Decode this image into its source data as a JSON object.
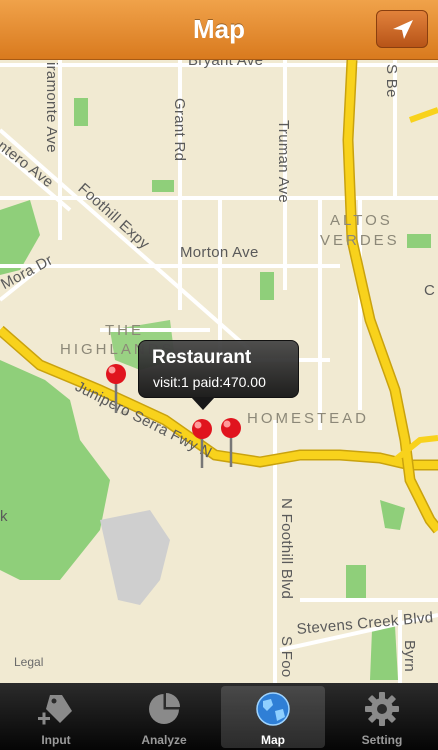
{
  "navbar": {
    "title": "Map",
    "locate_icon": "location-arrow-icon"
  },
  "map": {
    "streets": {
      "bryant": "Bryant Ave",
      "miramonte": "iramonte Ave",
      "grant": "Grant Rd",
      "truman": "Truman Ave",
      "sbe": "S Be",
      "montero": "ontero Ave",
      "foothill_expy": "Foothill Expy",
      "morton": "Morton Ave",
      "mora": "Mora Dr",
      "junipero": "Junipero Serra Fwy N",
      "n_foothill": "N Foothill Blvd",
      "s_foo": "S Foo",
      "stevens": "Stevens Creek Blvd",
      "byrn": "Byrn",
      "k": "k",
      "c": "C"
    },
    "areas": {
      "altos": "ALTOS",
      "verdes": "VERDES",
      "the": "THE",
      "highlands": "HIGHLANDS",
      "homestead": "HOMESTEAD"
    },
    "legal": "Legal"
  },
  "callout": {
    "title": "Restaurant",
    "subtitle": "visit:1 paid:470.00"
  },
  "tabs": [
    {
      "label": "Input",
      "icon": "tag-plus-icon"
    },
    {
      "label": "Analyze",
      "icon": "pie-chart-icon"
    },
    {
      "label": "Map",
      "icon": "globe-icon"
    },
    {
      "label": "Setting",
      "icon": "gear-icon"
    }
  ],
  "colors": {
    "navbar": "#e08a2c",
    "freeway": "#f8d21c",
    "park": "#8fcf7a",
    "pin": "#e0141e"
  }
}
